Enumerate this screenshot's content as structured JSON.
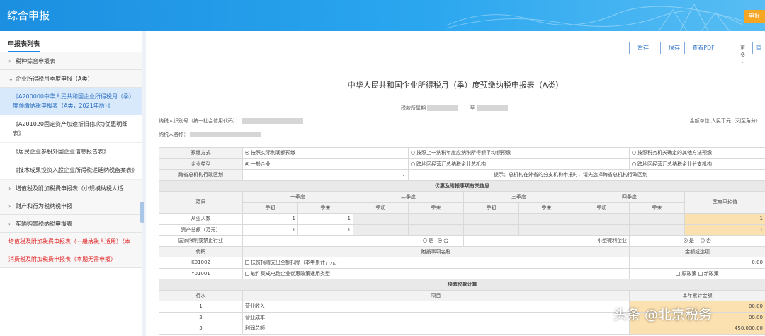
{
  "header": {
    "title": "综合申报",
    "right_button": "申报"
  },
  "sidebar": {
    "title": "申报表列表",
    "items": [
      {
        "label": "税种综合申报表",
        "chevron": "›"
      },
      {
        "label": "企业所得税月季度申报（A类）",
        "chevron": "⌄"
      }
    ],
    "sub_items": [
      {
        "label": "《A200000中华人民共和国企业所得税月（季）度预缴纳税申报表（A类，2021年版）》"
      },
      {
        "label": "《A201020固定资产加速折旧(扣除)优惠明细表》"
      },
      {
        "label": "《居民企业参股外国企业信息报告表》"
      },
      {
        "label": "《技术成果投资入股企业所得税递延纳税备案表》"
      }
    ],
    "items2": [
      {
        "label": "增值税及附加税费申报表（小规模纳税人适",
        "chevron": "›"
      },
      {
        "label": "财产和行为税纳税申报",
        "chevron": "›"
      },
      {
        "label": "车辆购置税纳税申报表",
        "chevron": "›"
      }
    ],
    "red_items": [
      {
        "label": "增值税及附加税费申报表（一般纳税人适用）（本"
      },
      {
        "label": "消费税及附加税费申报表（本期无需申报）"
      }
    ]
  },
  "toolbar": {
    "save_temp": "暂存",
    "save": "保存",
    "view_pdf": "查看PDF",
    "more": "更多",
    "more_icon": "⌄",
    "last": "重"
  },
  "form": {
    "title": "中华人民共和国企业所得税月（季）度预缴纳税申报表（A类）",
    "period_label": "税款所属期",
    "period_to": "至",
    "taxpayer_id_label": "纳税人识别号（统一社会信用代码）：",
    "taxpayer_name_label": "纳税人名称：",
    "unit": "金额单位:人民币元（列至角分）"
  },
  "grid": {
    "prepay_method": "预缴方式",
    "prepay_opt1": "按照实际利润额预缴",
    "prepay_opt2": "按照上一纳税年度应纳税所得额平均额预缴",
    "prepay_opt3": "按照税务机关确定的其他方法预缴",
    "company_type": "企业类型",
    "company_opt1": "一般企业",
    "company_opt2": "跨地区经营汇总纳税企业总机构",
    "company_opt3": "跨地区经营汇总纳税企业分支机构",
    "cross_region": "跨省总机构行政区划",
    "cross_dropdown": "⌄",
    "hint": "提示：总机构在外省的分支机构申报时，请先选择跨省总机构行政区划",
    "section1": "优惠及附报事项有关信息",
    "item": "项目",
    "q1": "一季度",
    "q2": "二季度",
    "q3": "三季度",
    "q4": "四季度",
    "avg": "季度平均值",
    "begin": "季初",
    "end": "季末",
    "employees": "从业人数",
    "assets": "资产总额（万元）",
    "restricted": "国家限制或禁止行业",
    "small": "小型微利企业",
    "yes": "是",
    "no": "否",
    "emp_q1_begin": "1",
    "emp_q1_end": "1",
    "emp_avg": "1",
    "ast_q1_begin": "1",
    "ast_q1_end": "1",
    "ast_avg": "1",
    "code": "代码",
    "item_name": "附报事项名称",
    "amount_or_option": "金额或选项",
    "k_code": "K01002",
    "k_name": "扶贫捐赠支出全额扣除（本年累计，元）",
    "k_value": "0.00",
    "y_code": "Y01001",
    "y_name": "软件集成电路企业优惠政策适用类型",
    "y_opt1": "原政策",
    "y_opt2": "新政策",
    "section2": "预缴税款计算",
    "row_no": "行次",
    "proj": "项目",
    "ytd": "本年累计金额",
    "r1_no": "1",
    "r1_name": "营业收入",
    "r1_val": "00.00",
    "r2_no": "2",
    "r2_name": "营业成本",
    "r2_val": "00.00",
    "r3_no": "3",
    "r3_name": "利润总额",
    "r3_val": "450,000.00"
  },
  "watermark": "头条 @北京税务"
}
